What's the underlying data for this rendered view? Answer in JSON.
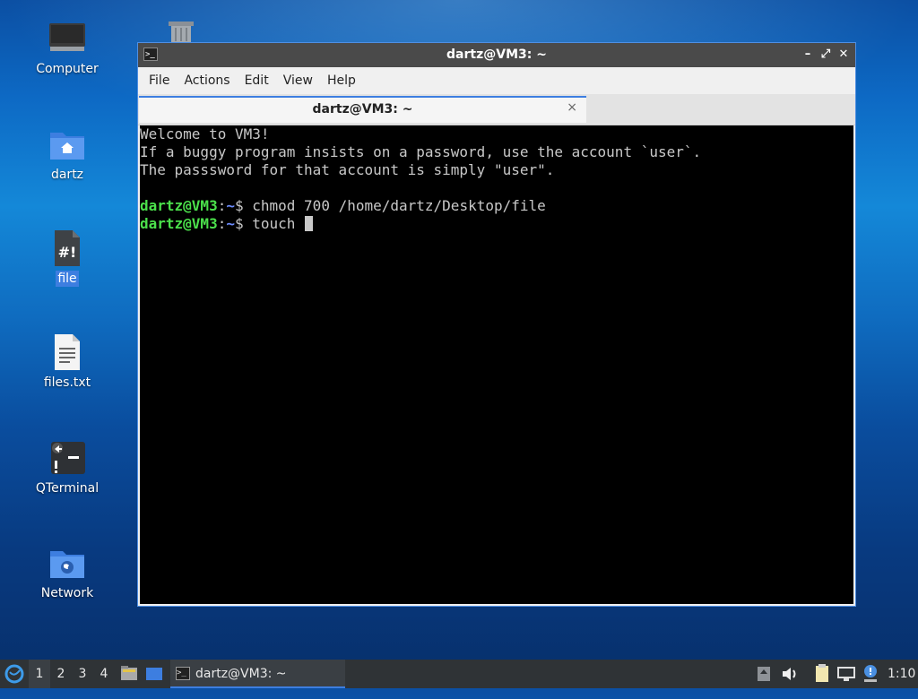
{
  "desktop": {
    "icons": [
      {
        "label": "Computer",
        "icon": "computer-icon"
      },
      {
        "label": "dartz",
        "icon": "home-folder-icon"
      },
      {
        "label": "file",
        "icon": "script-file-icon",
        "selected": true
      },
      {
        "label": "files.txt",
        "icon": "text-file-icon"
      },
      {
        "label": "QTerminal",
        "icon": "terminal-launcher-icon"
      },
      {
        "label": "Network",
        "icon": "network-folder-icon"
      }
    ],
    "trash_icon": "trash-icon"
  },
  "window": {
    "title": "dartz@VM3: ~",
    "controls": {
      "minimize": "–",
      "maximize": "⤢",
      "close": "✕"
    },
    "menu": [
      "File",
      "Actions",
      "Edit",
      "View",
      "Help"
    ],
    "tab": {
      "label": "dartz@VM3: ~",
      "close": "×"
    }
  },
  "terminal": {
    "lines": [
      "Welcome to VM3!",
      "If a buggy program insists on a password, use the account `user`.",
      "The passsword for that account is simply \"user\"."
    ],
    "prompt_user": "dartz@VM3",
    "prompt_sep": ":",
    "prompt_path": "~",
    "prompt_dollar": "$ ",
    "commands": [
      "chmod 700 /home/dartz/Desktop/file",
      "touch "
    ]
  },
  "taskbar": {
    "desktops": [
      "1",
      "2",
      "3",
      "4"
    ],
    "active_desktop": "1",
    "task": "dartz@VM3: ~",
    "clock": "1:10"
  },
  "colors": {
    "prompt_user": "#4be04b",
    "prompt_path": "#6d8dff",
    "accent": "#3d7ee0"
  }
}
